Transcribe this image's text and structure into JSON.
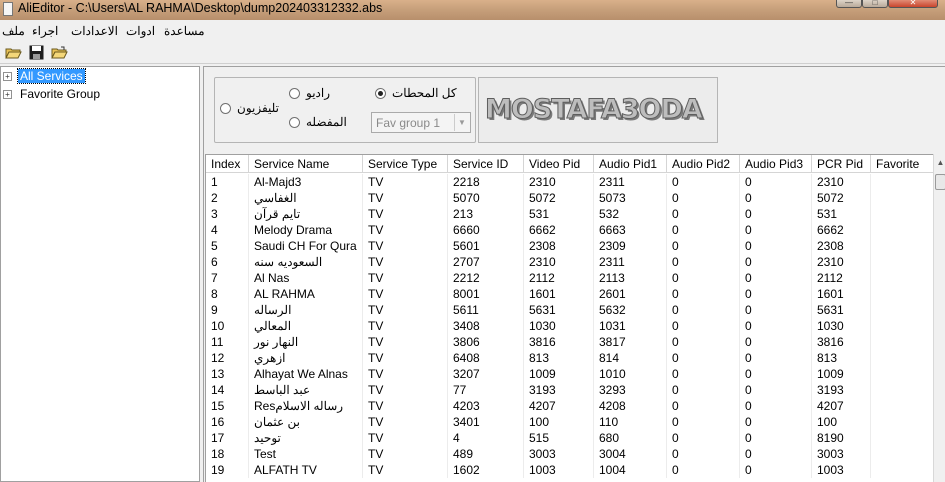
{
  "window": {
    "title": "AliEditor - C:\\Users\\AL RAHMA\\Desktop\\dump202403312332.abs",
    "minimize": "—",
    "maximize": "□",
    "close": "✕"
  },
  "menu": {
    "items": [
      "ملف",
      "اجراء",
      "الاعدادات",
      "ادوات",
      "مساعدة"
    ]
  },
  "toolbar": {
    "icons": [
      "open-folder-icon",
      "save-icon",
      "open-icon"
    ]
  },
  "tree": {
    "items": [
      {
        "label": "All Services",
        "selected": true,
        "expander": "+"
      },
      {
        "label": "Favorite Group",
        "selected": false,
        "expander": "+"
      }
    ]
  },
  "filters": {
    "all_label": "كل المحطات",
    "radio_label": "راديو",
    "tv_label": "تليفزيون",
    "fav_label": "المفضله",
    "selected": "all",
    "fav_group_value": "Fav group 1"
  },
  "logo": {
    "text": "MOSTAFA3ODA"
  },
  "table": {
    "columns": [
      "Index",
      "Service Name",
      "Service Type",
      "Service ID",
      "Video Pid",
      "Audio Pid1",
      "Audio Pid2",
      "Audio Pid3",
      "PCR Pid",
      "Favorite"
    ],
    "rows": [
      [
        "1",
        "Al-Majd3",
        "TV",
        "2218",
        "2310",
        "2311",
        "0",
        "0",
        "2310",
        ""
      ],
      [
        "2",
        "الغفاسي",
        "TV",
        "5070",
        "5072",
        "5073",
        "0",
        "0",
        "5072",
        ""
      ],
      [
        "3",
        "تايم قرآن",
        "TV",
        "213",
        "531",
        "532",
        "0",
        "0",
        "531",
        ""
      ],
      [
        "4",
        "Melody Drama",
        "TV",
        "6660",
        "6662",
        "6663",
        "0",
        "0",
        "6662",
        ""
      ],
      [
        "5",
        "Saudi CH For Qura",
        "TV",
        "5601",
        "2308",
        "2309",
        "0",
        "0",
        "2308",
        ""
      ],
      [
        "6",
        "السعوديه سنه",
        "TV",
        "2707",
        "2310",
        "2311",
        "0",
        "0",
        "2310",
        ""
      ],
      [
        "7",
        "Al Nas",
        "TV",
        "2212",
        "2112",
        "2113",
        "0",
        "0",
        "2112",
        ""
      ],
      [
        "8",
        "AL RAHMA",
        "TV",
        "8001",
        "1601",
        "2601",
        "0",
        "0",
        "1601",
        ""
      ],
      [
        "9",
        "الرساله",
        "TV",
        "5611",
        "5631",
        "5632",
        "0",
        "0",
        "5631",
        ""
      ],
      [
        "10",
        "المعالي",
        "TV",
        "3408",
        "1030",
        "1031",
        "0",
        "0",
        "1030",
        ""
      ],
      [
        "11",
        "النهار نور",
        "TV",
        "3806",
        "3816",
        "3817",
        "0",
        "0",
        "3816",
        ""
      ],
      [
        "12",
        "ازهري",
        "TV",
        "6408",
        "813",
        "814",
        "0",
        "0",
        "813",
        ""
      ],
      [
        "13",
        "Alhayat We Alnas",
        "TV",
        "3207",
        "1009",
        "1010",
        "0",
        "0",
        "1009",
        ""
      ],
      [
        "14",
        "عبد الباسط",
        "TV",
        "77",
        "3193",
        "3293",
        "0",
        "0",
        "3193",
        ""
      ],
      [
        "15",
        "Resرساله الاسلام",
        "TV",
        "4203",
        "4207",
        "4208",
        "0",
        "0",
        "4207",
        ""
      ],
      [
        "16",
        "بن عثمان",
        "TV",
        "3401",
        "100",
        "110",
        "0",
        "0",
        "100",
        ""
      ],
      [
        "17",
        "توحيد",
        "TV",
        "4",
        "515",
        "680",
        "0",
        "0",
        "8190",
        ""
      ],
      [
        "18",
        "Test",
        "TV",
        "489",
        "3003",
        "3004",
        "0",
        "0",
        "3003",
        ""
      ],
      [
        "19",
        "ALFATH TV",
        "TV",
        "1602",
        "1003",
        "1004",
        "0",
        "0",
        "1003",
        ""
      ]
    ]
  },
  "colors": {
    "selection": "#3399ff",
    "titlebar": "#c7a07b"
  }
}
